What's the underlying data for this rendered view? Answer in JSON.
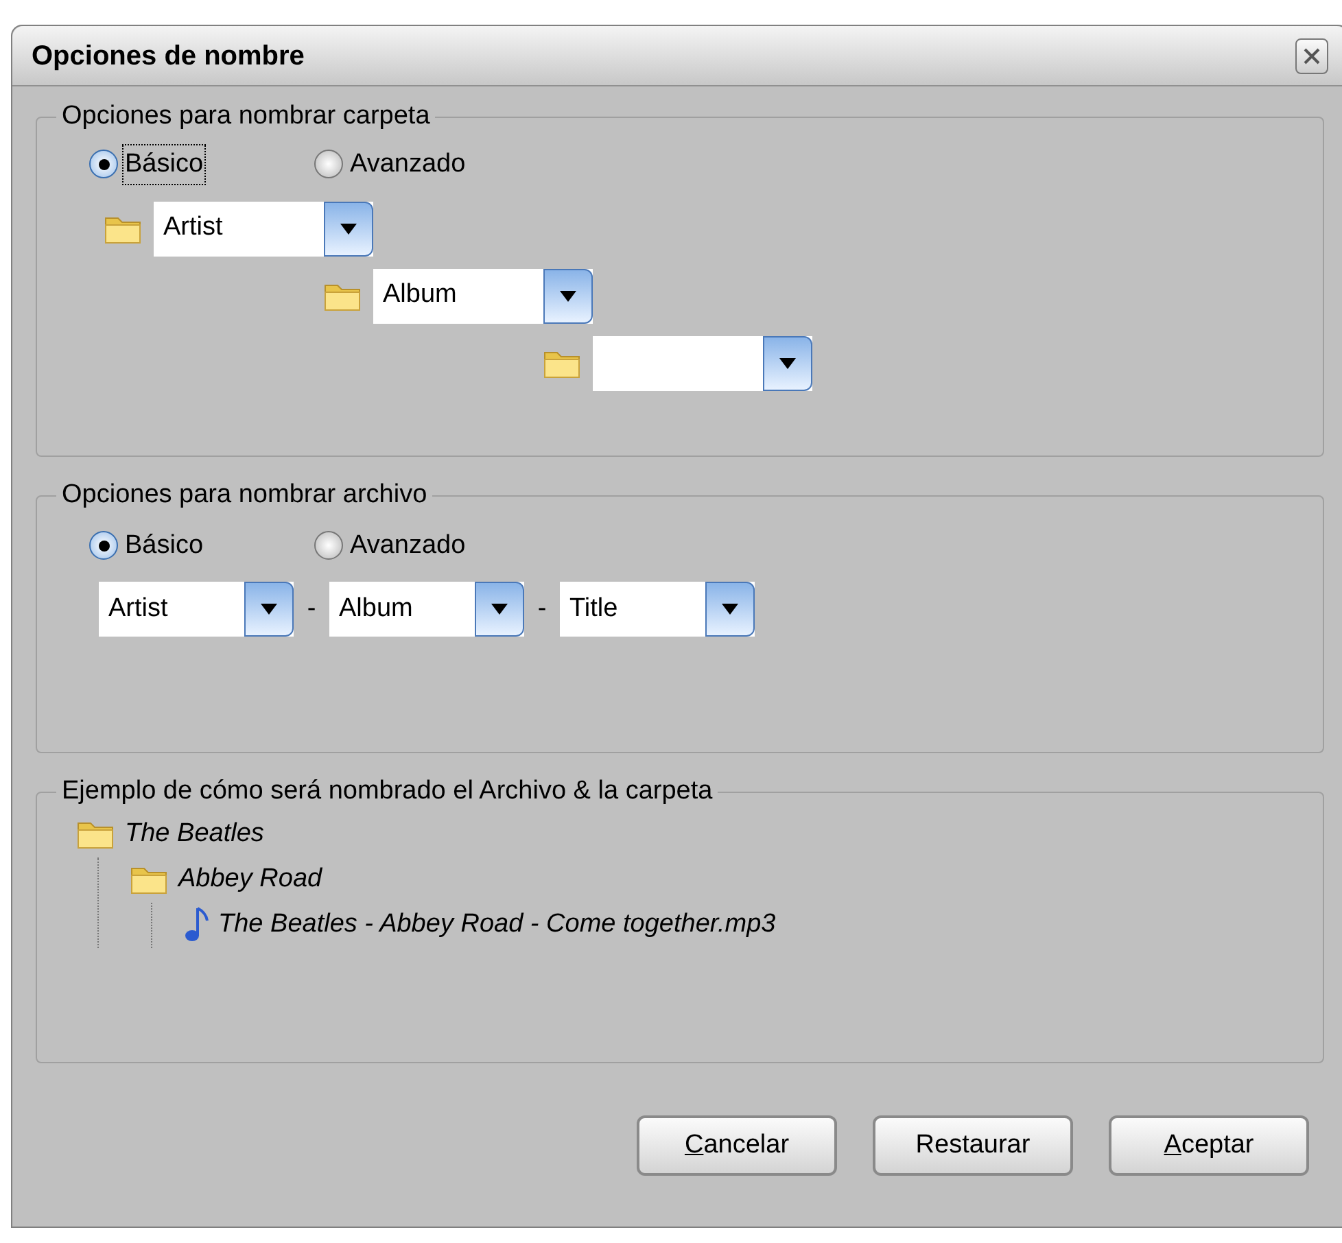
{
  "window": {
    "title": "Opciones de nombre"
  },
  "folder_options": {
    "title": "Opciones para nombrar carpeta",
    "radios": [
      {
        "label": "Básico",
        "selected": true,
        "focused": true
      },
      {
        "label": "Avanzado",
        "selected": false,
        "focused": false
      }
    ],
    "levels": [
      {
        "kind": "dropdown",
        "value": "Artist"
      },
      {
        "kind": "dropdown",
        "value": "Album"
      },
      {
        "kind": "dropdown"
      }
    ]
  },
  "file_options": {
    "title": "Opciones para nombrar archivo",
    "radios": [
      {
        "label": "Básico",
        "selected": true,
        "focused": false
      },
      {
        "label": "Avanzado",
        "selected": false,
        "focused": false
      }
    ],
    "fields": [
      {
        "value": "Artist"
      },
      {
        "value": "Album"
      },
      {
        "value": "Title"
      }
    ],
    "separators": [
      "-",
      "-"
    ]
  },
  "example": {
    "title": "Ejemplo de cómo será nombrado el Archivo & la carpeta",
    "tree": [
      {
        "kind": "folder",
        "label": "The Beatles",
        "children": [
          {
            "kind": "folder",
            "label": "Abbey Road",
            "children": [
              {
                "kind": "file",
                "label": "The Beatles - Abbey Road - Come together.mp3"
              }
            ]
          }
        ]
      }
    ]
  },
  "buttons": [
    {
      "label": "Cancelar",
      "mnemonic": true
    },
    {
      "label": "Restaurar",
      "mnemonic": false
    },
    {
      "label": "Aceptar",
      "mnemonic": true
    }
  ]
}
